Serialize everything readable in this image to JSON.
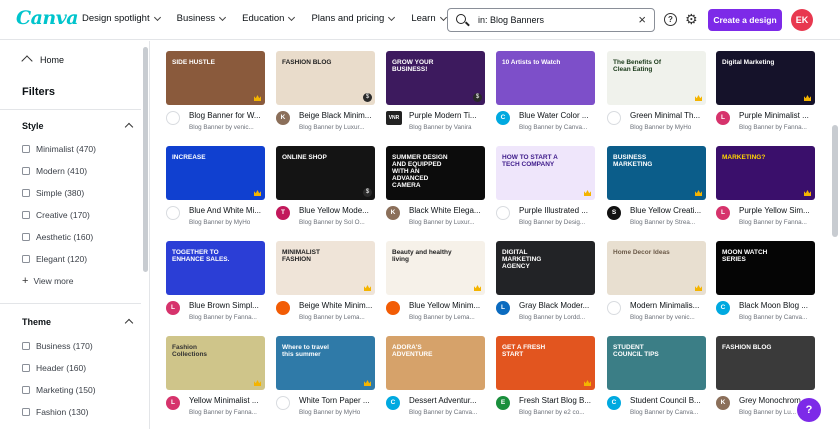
{
  "app": {
    "logo": "Canva"
  },
  "nav": [
    {
      "label": "Design spotlight"
    },
    {
      "label": "Business"
    },
    {
      "label": "Education"
    },
    {
      "label": "Plans and pricing"
    },
    {
      "label": "Learn"
    }
  ],
  "search": {
    "value": "in: Blog Banners",
    "clear_glyph": "×"
  },
  "header": {
    "help_glyph": "?",
    "gear_glyph": "⚙",
    "create_label": "Create a design",
    "avatar_initials": "EK",
    "accent": "#7d2ae8",
    "avatar_color": "#e8384f"
  },
  "sidebar": {
    "home_label": "Home",
    "filters_title": "Filters",
    "style": {
      "title": "Style",
      "items": [
        "Minimalist (470)",
        "Modern (410)",
        "Simple (380)",
        "Creative (170)",
        "Aesthetic (160)",
        "Elegant (120)"
      ],
      "view_more": "View more"
    },
    "theme": {
      "title": "Theme",
      "items": [
        "Business (170)",
        "Header (160)",
        "Marketing (150)",
        "Fashion (130)"
      ]
    }
  },
  "templates": [
    {
      "title": "Blog Banner for W...",
      "sub": "Blog Banner by venic...",
      "thumb_text": "SIDE HUSTLE",
      "bg": "#8a5a3c",
      "fg": "#ffffff",
      "avatar": "",
      "avatar_color": "#ffffff",
      "badge": "crown"
    },
    {
      "title": "Beige Black Minim...",
      "sub": "Blog Banner by Luxur...",
      "thumb_text": "FASHION BLOG",
      "bg": "#e9dccb",
      "fg": "#222222",
      "avatar": "K",
      "avatar_color": "#8b6f5a",
      "badge": "price"
    },
    {
      "title": "Purple Modern Ti...",
      "sub": "Blog Banner by Vanira",
      "thumb_text": "GROW YOUR BUSINESS!",
      "bg": "#3d1a5e",
      "fg": "#ffffff",
      "avatar": "VNR",
      "avatar_color": "#222222",
      "badge": "price"
    },
    {
      "title": "Blue Water Color ...",
      "sub": "Blog Banner by Canva...",
      "thumb_text": "10 Artists to Watch",
      "bg": "#7d4fc9",
      "fg": "#ffffff",
      "avatar": "C",
      "avatar_color": "#00a9e0",
      "badge": "none"
    },
    {
      "title": "Green Minimal Th...",
      "sub": "Blog Banner by MyHo",
      "thumb_text": "The Benefits Of Clean Eating",
      "bg": "#f0f2ec",
      "fg": "#1a3a1a",
      "avatar": "",
      "avatar_color": "#ffffff",
      "badge": "crown"
    },
    {
      "title": "Purple Minimalist ...",
      "sub": "Blog Banner by Fanna...",
      "thumb_text": "Digital Marketing",
      "bg": "#15122a",
      "fg": "#ffffff",
      "avatar": "L",
      "avatar_color": "#d6336c",
      "badge": "crown"
    },
    {
      "title": "Blue And White Mi...",
      "sub": "Blog Banner by MyHo",
      "thumb_text": "INCREASE",
      "bg": "#1040d0",
      "fg": "#ffffff",
      "avatar": "",
      "avatar_color": "#ffffff",
      "badge": "crown"
    },
    {
      "title": "Blue Yellow Mode...",
      "sub": "Blog Banner by Sol O...",
      "thumb_text": "ONLINE SHOP",
      "bg": "#141414",
      "fg": "#ffffff",
      "avatar": "T",
      "avatar_color": "#c2185b",
      "badge": "price"
    },
    {
      "title": "Black White Elega...",
      "sub": "Blog Banner by Luxur...",
      "thumb_text": "SUMMER DESIGN AND EQUIPPED WITH AN ADVANCED CAMERA",
      "bg": "#0c0c0c",
      "fg": "#ffffff",
      "avatar": "K",
      "avatar_color": "#8b6f5a",
      "badge": "none"
    },
    {
      "title": "Purple Illustrated ...",
      "sub": "Blog Banner by Desig...",
      "thumb_text": "HOW TO START A TECH COMPANY",
      "bg": "#efe6fb",
      "fg": "#3d1a8a",
      "avatar": "",
      "avatar_color": "#ffffff",
      "badge": "crown"
    },
    {
      "title": "Blue Yellow Creati...",
      "sub": "Blog Banner by Strea...",
      "thumb_text": "BUSINESS MARKETING",
      "bg": "#0b5d8a",
      "fg": "#ffffff",
      "avatar": "S",
      "avatar_color": "#111111",
      "badge": "crown"
    },
    {
      "title": "Purple Yellow Sim...",
      "sub": "Blog Banner by Fanna...",
      "thumb_text": "MARKETING?",
      "bg": "#3a0f6b",
      "fg": "#ffd400",
      "avatar": "L",
      "avatar_color": "#d6336c",
      "badge": "crown"
    },
    {
      "title": "Blue Brown Simpl...",
      "sub": "Blog Banner by Fanna...",
      "thumb_text": "TOGETHER TO ENHANCE SALES.",
      "bg": "#2b3ed6",
      "fg": "#ffffff",
      "avatar": "L",
      "avatar_color": "#d6336c",
      "badge": "none"
    },
    {
      "title": "Beige White Minim...",
      "sub": "Blog Banner by Lema...",
      "thumb_text": "MINIMALIST FASHION",
      "bg": "#efe4d8",
      "fg": "#222222",
      "avatar": "",
      "avatar_color": "#f25c05",
      "badge": "crown"
    },
    {
      "title": "Blue Yellow Minim...",
      "sub": "Blog Banner by Lema...",
      "thumb_text": "Beauty and healthy living",
      "bg": "#f6f1e9",
      "fg": "#222222",
      "avatar": "",
      "avatar_color": "#f25c05",
      "badge": "crown"
    },
    {
      "title": "Gray Black Moder...",
      "sub": "Blog Banner by Lordd...",
      "thumb_text": "DIGITAL MARKETING AGENCY",
      "bg": "#222326",
      "fg": "#ffffff",
      "avatar": "L",
      "avatar_color": "#0b6bbf",
      "badge": "none"
    },
    {
      "title": "Modern Minimalis...",
      "sub": "Blog Banner by venic...",
      "thumb_text": "Home Decor Ideas",
      "bg": "#e8dfd0",
      "fg": "#6b5a48",
      "avatar": "",
      "avatar_color": "#ffffff",
      "badge": "crown"
    },
    {
      "title": "Black Moon Blog ...",
      "sub": "Blog Banner by Canva...",
      "thumb_text": "MOON WATCH SERIES",
      "bg": "#050505",
      "fg": "#ffffff",
      "avatar": "C",
      "avatar_color": "#00a9e0",
      "badge": "none"
    },
    {
      "title": "Yellow Minimalist ...",
      "sub": "Blog Banner by Fanna...",
      "thumb_text": "Fashion Collections",
      "bg": "#cfc58a",
      "fg": "#333333",
      "avatar": "L",
      "avatar_color": "#d6336c",
      "badge": "crown"
    },
    {
      "title": "White Torn Paper ...",
      "sub": "Blog Banner by MyHo",
      "thumb_text": "Where to travel this summer",
      "bg": "#2f7aa8",
      "fg": "#ffffff",
      "avatar": "",
      "avatar_color": "#ffffff",
      "badge": "crown"
    },
    {
      "title": "Dessert Adventur...",
      "sub": "Blog Banner by Canva...",
      "thumb_text": "ADORA'S ADVENTURE",
      "bg": "#d6a26a",
      "fg": "#ffffff",
      "avatar": "C",
      "avatar_color": "#00a9e0",
      "badge": "none"
    },
    {
      "title": "Fresh Start Blog B...",
      "sub": "Blog Banner by e2 co...",
      "thumb_text": "GET A FRESH START",
      "bg": "#e2551f",
      "fg": "#ffffff",
      "avatar": "E",
      "avatar_color": "#1a8f3c",
      "badge": "crown"
    },
    {
      "title": "Student Council B...",
      "sub": "Blog Banner by Canva...",
      "thumb_text": "STUDENT COUNCIL TIPS",
      "bg": "#3b7e86",
      "fg": "#ffffff",
      "avatar": "C",
      "avatar_color": "#00a9e0",
      "badge": "none"
    },
    {
      "title": "Grey Monochrom...",
      "sub": "Blog Banner by Lu...",
      "thumb_text": "FASHION BLOG",
      "bg": "#3a3a3a",
      "fg": "#ffffff",
      "avatar": "K",
      "avatar_color": "#8b6f5a",
      "badge": "none"
    }
  ],
  "help_fab": "?"
}
